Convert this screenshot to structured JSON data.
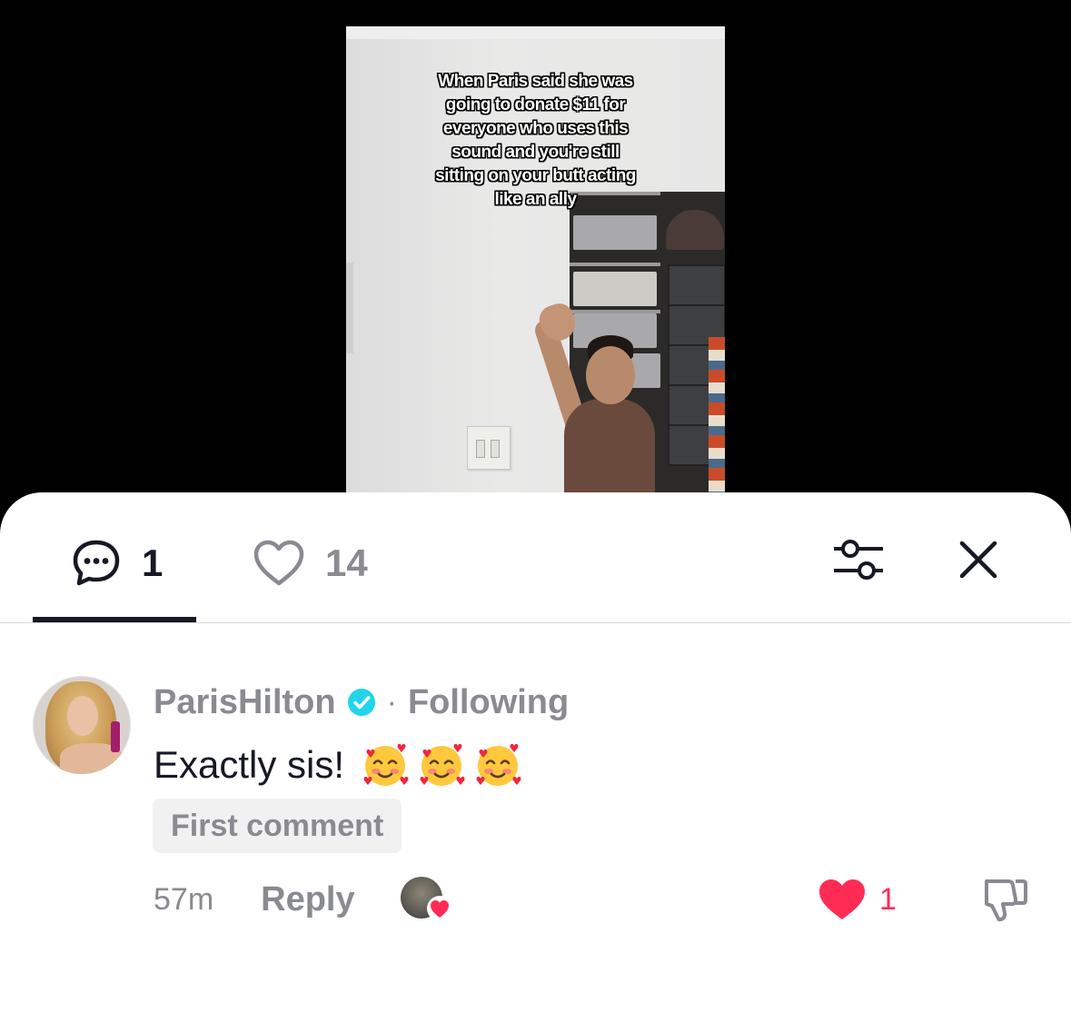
{
  "video": {
    "caption": "When Paris said she was\ngoing to donate $11 for\neveryone who uses this\nsound and you're still\nsitting on your butt acting\nlike an ally"
  },
  "tabs": {
    "comments": {
      "icon": "comment-bubble-icon",
      "count": "1"
    },
    "likes": {
      "icon": "heart-outline-icon",
      "count": "14"
    }
  },
  "toolbar": {
    "filter_icon": "sliders-icon",
    "close_icon": "close-icon"
  },
  "comment": {
    "username": "ParisHilton",
    "verified_icon": "verified-badge-icon",
    "separator": "·",
    "relationship": "Following",
    "text": "Exactly sis!",
    "emojis": [
      "smiling-face-with-hearts",
      "smiling-face-with-hearts",
      "smiling-face-with-hearts"
    ],
    "badge": "First comment",
    "timestamp": "57m",
    "reply_label": "Reply",
    "like_count": "1"
  },
  "colors": {
    "primary_text": "#161823",
    "secondary_text": "#8a8b91",
    "like_red": "#fe2c55",
    "verified_blue": "#20d5ec",
    "badge_bg": "#f1f1f2"
  }
}
